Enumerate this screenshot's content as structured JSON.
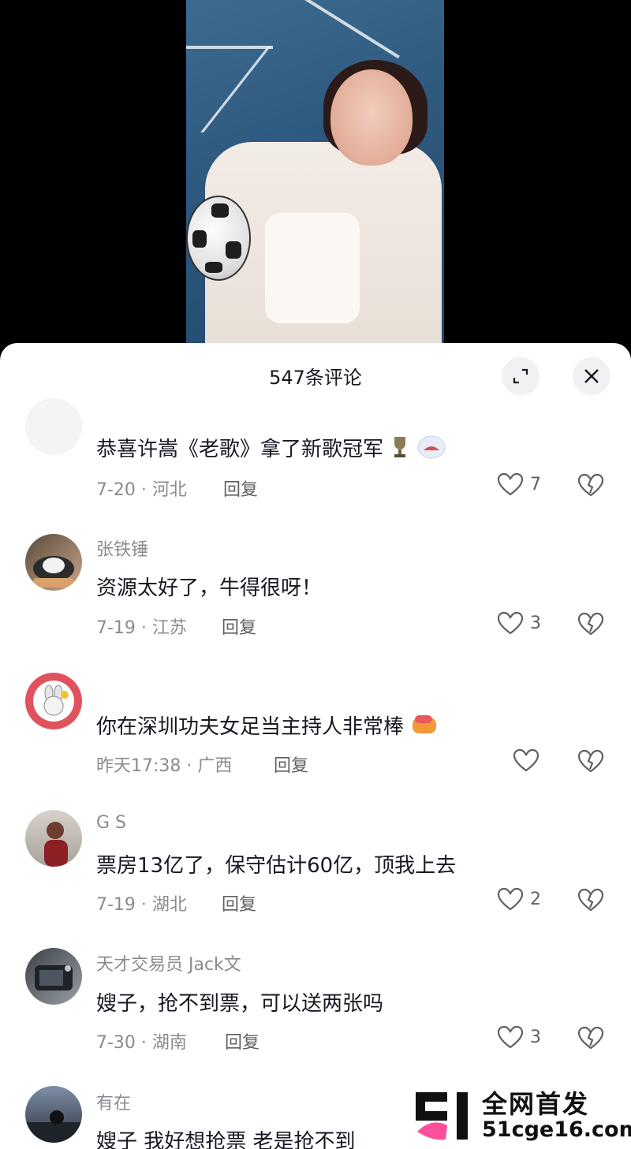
{
  "sheet": {
    "title": "547条评论",
    "expand_icon": "expand-icon",
    "close_icon": "close-icon"
  },
  "comments": [
    {
      "name": "",
      "text": "恭喜许嵩《老歌》拿了新歌冠军",
      "time_location": "7-20 · 河北",
      "reply_label": "回复",
      "likes": "7"
    },
    {
      "name": "张铁锤",
      "text": "资源太好了，牛得很呀！",
      "time_location": "7-19 · 江苏",
      "reply_label": "回复",
      "likes": "3"
    },
    {
      "name": "",
      "text": "你在深圳功夫女足当主持人非常棒",
      "time_location": "昨天17:38 · 广西",
      "reply_label": "回复",
      "likes": ""
    },
    {
      "name": "G S",
      "text": "票房13亿了，保守估计60亿，顶我上去",
      "time_location": "7-19 · 湖北",
      "reply_label": "回复",
      "likes": "2"
    },
    {
      "name": "天才交易员 Jack文",
      "text": "嫂子，抢不到票，可以送两张吗",
      "time_location": "7-30 · 湖南",
      "reply_label": "回复",
      "likes": "3"
    },
    {
      "name": "有在",
      "text": "嫂子 我好想抢票 老是抢不到",
      "time_location": "",
      "reply_label": "",
      "likes": ""
    }
  ],
  "watermark": {
    "title": "全网首发",
    "url": "51cge16.com"
  },
  "colors": {
    "primary_text": "#161823",
    "secondary_text": "#8a8b91",
    "button_bg": "#f1f1f2"
  }
}
